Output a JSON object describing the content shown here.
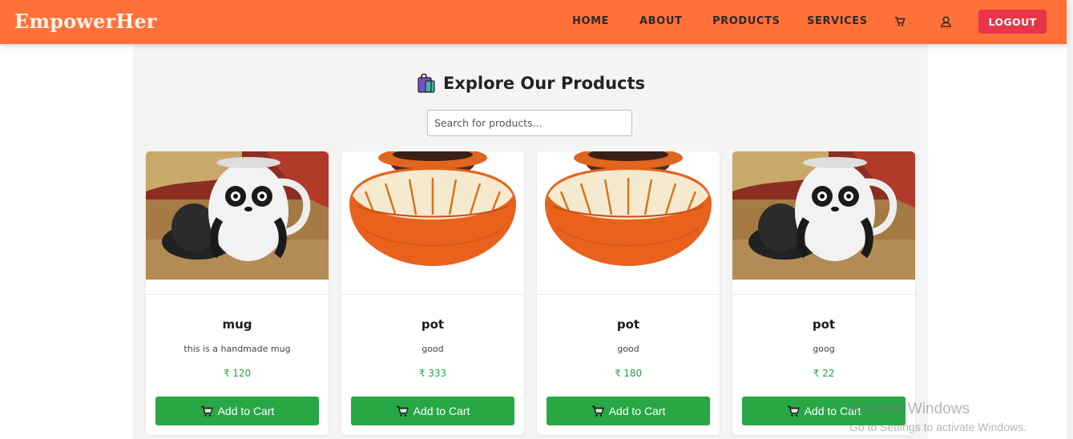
{
  "header": {
    "brand": "EmpowerHer",
    "nav": [
      "HOME",
      "ABOUT",
      "PRODUCTS",
      "SERVICES"
    ],
    "cart_icon": "cart-icon",
    "user_icon": "user-icon",
    "logout_label": "LOGOUT",
    "accent_color": "#ff7139"
  },
  "main": {
    "title": "Explore Our Products",
    "title_icon": "shopping-bag-icon",
    "search_placeholder": "Search for products..."
  },
  "products": [
    {
      "name": "mug",
      "description": "this is a handmade mug",
      "price": "₹ 120",
      "image": "panda-mug",
      "button": "Add to Cart"
    },
    {
      "name": "pot",
      "description": "good",
      "price": "₹ 333",
      "image": "clay-pot",
      "button": "Add to Cart"
    },
    {
      "name": "pot",
      "description": "good",
      "price": "₹ 180",
      "image": "clay-pot",
      "button": "Add to Cart"
    },
    {
      "name": "pot",
      "description": "goog",
      "price": "₹ 22",
      "image": "panda-mug",
      "button": "Add to Cart"
    }
  ],
  "os_watermark": {
    "title": "Activate Windows",
    "subtitle": "Go to Settings to activate Windows."
  }
}
